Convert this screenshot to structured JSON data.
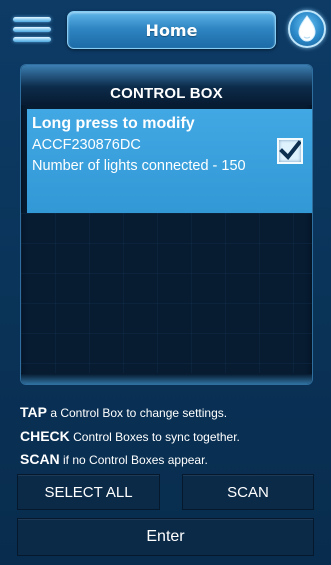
{
  "header": {
    "title": "Home",
    "menu_icon": "hamburger-menu-icon",
    "bulb_icon": "light-bulb-icon"
  },
  "panel": {
    "title": "CONTROL BOX",
    "items": [
      {
        "hint": "Long press to modify",
        "id": "ACCF230876DC",
        "lights": "Number of lights connected - 150",
        "checked": true
      }
    ]
  },
  "instructions": [
    {
      "keyword": "TAP",
      "text": "a Control Box to change settings."
    },
    {
      "keyword": "CHECK",
      "text": "Control Boxes to sync together."
    },
    {
      "keyword": "SCAN",
      "text": "if no Control Boxes appear."
    }
  ],
  "buttons": {
    "select_all": "SELECT ALL",
    "scan": "SCAN",
    "enter": "Enter"
  },
  "colors": {
    "background": "#0b3a63",
    "item_highlight": "#3aa0dd",
    "accent": "#2f86c2"
  }
}
